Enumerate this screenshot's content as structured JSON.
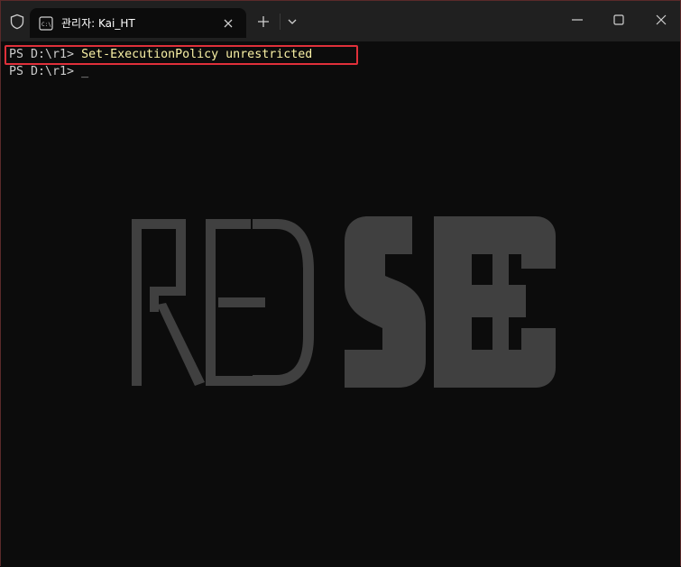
{
  "tab": {
    "title": "관리자: Kai_HT"
  },
  "terminal": {
    "line1_prompt": "PS D:\\r1> ",
    "line1_command": "Set-ExecutionPolicy unrestricted",
    "line2_prompt": "PS D:\\r1> ",
    "cursor": "_"
  },
  "colors": {
    "background": "#0c0c0c",
    "titlebar": "#202020",
    "text": "#cccccc",
    "command": "#f9f1a5",
    "highlight_border": "#e0303a",
    "logo": "#404040"
  },
  "icons": {
    "shield": "shield-icon",
    "terminal": "terminal-icon",
    "close_tab": "close-icon",
    "new_tab": "plus-icon",
    "dropdown": "chevron-down-icon",
    "minimize": "minimize-icon",
    "maximize": "maximize-icon",
    "close_window": "close-icon"
  },
  "logo_text": "RED SEC"
}
